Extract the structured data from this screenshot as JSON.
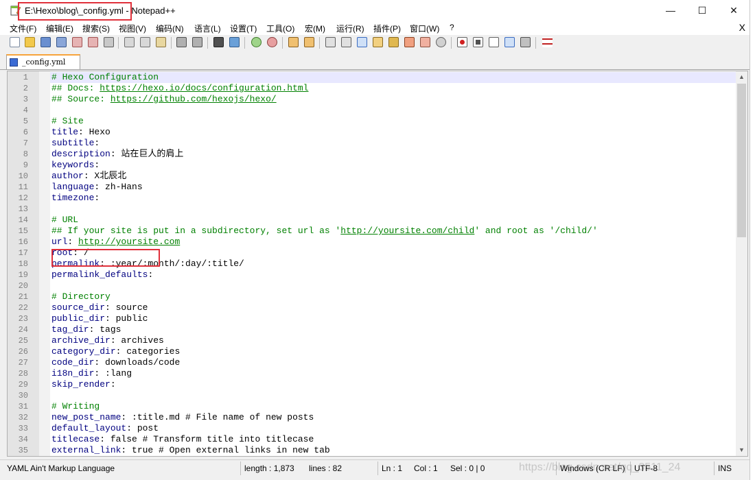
{
  "window": {
    "title": "E:\\Hexo\\blog\\_config.yml - Notepad++",
    "controls": {
      "minimize": "—",
      "maximize": "☐",
      "close": "✕"
    }
  },
  "menu": {
    "items": [
      {
        "label": "文件(F)"
      },
      {
        "label": "编辑(E)"
      },
      {
        "label": "搜索(S)"
      },
      {
        "label": "视图(V)"
      },
      {
        "label": "编码(N)"
      },
      {
        "label": "语言(L)"
      },
      {
        "label": "设置(T)"
      },
      {
        "label": "工具(O)"
      },
      {
        "label": "宏(M)"
      },
      {
        "label": "运行(R)"
      },
      {
        "label": "插件(P)"
      },
      {
        "label": "窗口(W)"
      },
      {
        "label": "?"
      }
    ],
    "close_label": "X"
  },
  "tab": {
    "label": "_config.yml"
  },
  "editor": {
    "lines": [
      {
        "n": "1",
        "parts": [
          {
            "t": "# Hexo Configuration",
            "c": "cmt"
          }
        ]
      },
      {
        "n": "2",
        "parts": [
          {
            "t": "## Docs: ",
            "c": "cmt"
          },
          {
            "t": "https://hexo.io/docs/configuration.html",
            "c": "link"
          }
        ]
      },
      {
        "n": "3",
        "parts": [
          {
            "t": "## Source: ",
            "c": "cmt"
          },
          {
            "t": "https://github.com/hexojs/hexo/",
            "c": "link"
          }
        ]
      },
      {
        "n": "4",
        "parts": []
      },
      {
        "n": "5",
        "parts": [
          {
            "t": "# Site",
            "c": "cmt"
          }
        ]
      },
      {
        "n": "6",
        "parts": [
          {
            "t": "title",
            "c": "key"
          },
          {
            "t": ": Hexo",
            "c": "val"
          }
        ]
      },
      {
        "n": "7",
        "parts": [
          {
            "t": "subtitle",
            "c": "key"
          },
          {
            "t": ":",
            "c": "val"
          }
        ]
      },
      {
        "n": "8",
        "parts": [
          {
            "t": "description",
            "c": "key"
          },
          {
            "t": ": 站在巨人的肩上",
            "c": "val"
          }
        ]
      },
      {
        "n": "9",
        "parts": [
          {
            "t": "keywords",
            "c": "key"
          },
          {
            "t": ":",
            "c": "val"
          }
        ]
      },
      {
        "n": "10",
        "parts": [
          {
            "t": "author",
            "c": "key"
          },
          {
            "t": ": X北辰北",
            "c": "val"
          }
        ]
      },
      {
        "n": "11",
        "parts": [
          {
            "t": "language",
            "c": "key"
          },
          {
            "t": ": zh-Hans",
            "c": "val"
          }
        ]
      },
      {
        "n": "12",
        "parts": [
          {
            "t": "timezone",
            "c": "key"
          },
          {
            "t": ":",
            "c": "val"
          }
        ]
      },
      {
        "n": "13",
        "parts": []
      },
      {
        "n": "14",
        "parts": [
          {
            "t": "# URL",
            "c": "cmt"
          }
        ]
      },
      {
        "n": "15",
        "parts": [
          {
            "t": "## If your site is put in a subdirectory, set url as '",
            "c": "cmt"
          },
          {
            "t": "http://yoursite.com/child",
            "c": "link"
          },
          {
            "t": "' and root as '/child/'",
            "c": "cmt"
          }
        ]
      },
      {
        "n": "16",
        "parts": [
          {
            "t": "url",
            "c": "key"
          },
          {
            "t": ": ",
            "c": "val"
          },
          {
            "t": "http://yoursite.com",
            "c": "link"
          }
        ]
      },
      {
        "n": "17",
        "parts": [
          {
            "t": "root",
            "c": "key"
          },
          {
            "t": ": /",
            "c": "val"
          }
        ]
      },
      {
        "n": "18",
        "parts": [
          {
            "t": "permalink",
            "c": "key"
          },
          {
            "t": ": :year/:month/:day/:title/",
            "c": "val"
          }
        ]
      },
      {
        "n": "19",
        "parts": [
          {
            "t": "permalink_defaults",
            "c": "key"
          },
          {
            "t": ":",
            "c": "val"
          }
        ]
      },
      {
        "n": "20",
        "parts": []
      },
      {
        "n": "21",
        "parts": [
          {
            "t": "# Directory",
            "c": "cmt"
          }
        ]
      },
      {
        "n": "22",
        "parts": [
          {
            "t": "source_dir",
            "c": "key"
          },
          {
            "t": ": source",
            "c": "val"
          }
        ]
      },
      {
        "n": "23",
        "parts": [
          {
            "t": "public_dir",
            "c": "key"
          },
          {
            "t": ": public",
            "c": "val"
          }
        ]
      },
      {
        "n": "24",
        "parts": [
          {
            "t": "tag_dir",
            "c": "key"
          },
          {
            "t": ": tags",
            "c": "val"
          }
        ]
      },
      {
        "n": "25",
        "parts": [
          {
            "t": "archive_dir",
            "c": "key"
          },
          {
            "t": ": archives",
            "c": "val"
          }
        ]
      },
      {
        "n": "26",
        "parts": [
          {
            "t": "category_dir",
            "c": "key"
          },
          {
            "t": ": categories",
            "c": "val"
          }
        ]
      },
      {
        "n": "27",
        "parts": [
          {
            "t": "code_dir",
            "c": "key"
          },
          {
            "t": ": downloads/code",
            "c": "val"
          }
        ]
      },
      {
        "n": "28",
        "parts": [
          {
            "t": "i18n_dir",
            "c": "key"
          },
          {
            "t": ": :lang",
            "c": "val"
          }
        ]
      },
      {
        "n": "29",
        "parts": [
          {
            "t": "skip_render",
            "c": "key"
          },
          {
            "t": ":",
            "c": "val"
          }
        ]
      },
      {
        "n": "30",
        "parts": []
      },
      {
        "n": "31",
        "parts": [
          {
            "t": "# Writing",
            "c": "cmt"
          }
        ]
      },
      {
        "n": "32",
        "parts": [
          {
            "t": "new_post_name",
            "c": "key"
          },
          {
            "t": ": :title.md ",
            "c": "val"
          },
          {
            "t": "# File name of new posts",
            "c": "val"
          }
        ]
      },
      {
        "n": "33",
        "parts": [
          {
            "t": "default_layout",
            "c": "key"
          },
          {
            "t": ": post",
            "c": "val"
          }
        ]
      },
      {
        "n": "34",
        "parts": [
          {
            "t": "titlecase",
            "c": "key"
          },
          {
            "t": ": false ",
            "c": "val"
          },
          {
            "t": "# Transform title into titlecase",
            "c": "val"
          }
        ]
      },
      {
        "n": "35",
        "parts": [
          {
            "t": "external_link",
            "c": "key"
          },
          {
            "t": ": true ",
            "c": "val"
          },
          {
            "t": "# Open external links in new tab",
            "c": "val"
          }
        ]
      }
    ]
  },
  "status": {
    "language": "YAML Ain't Markup Language",
    "length": "length : 1,873",
    "lines": "lines : 82",
    "ln": "Ln : 1",
    "col": "Col : 1",
    "sel": "Sel : 0 | 0",
    "eol": "Windows (CR LF)",
    "encoding": "UTF-8",
    "mode": "INS"
  },
  "watermark": "https://blog.csdn.net/qq_3511_24",
  "colors": {
    "highlight_box": "#e0303a",
    "comment": "#008000",
    "key": "#000080",
    "current_line": "#e8e8ff",
    "tab_accent": "#f7a33b"
  }
}
